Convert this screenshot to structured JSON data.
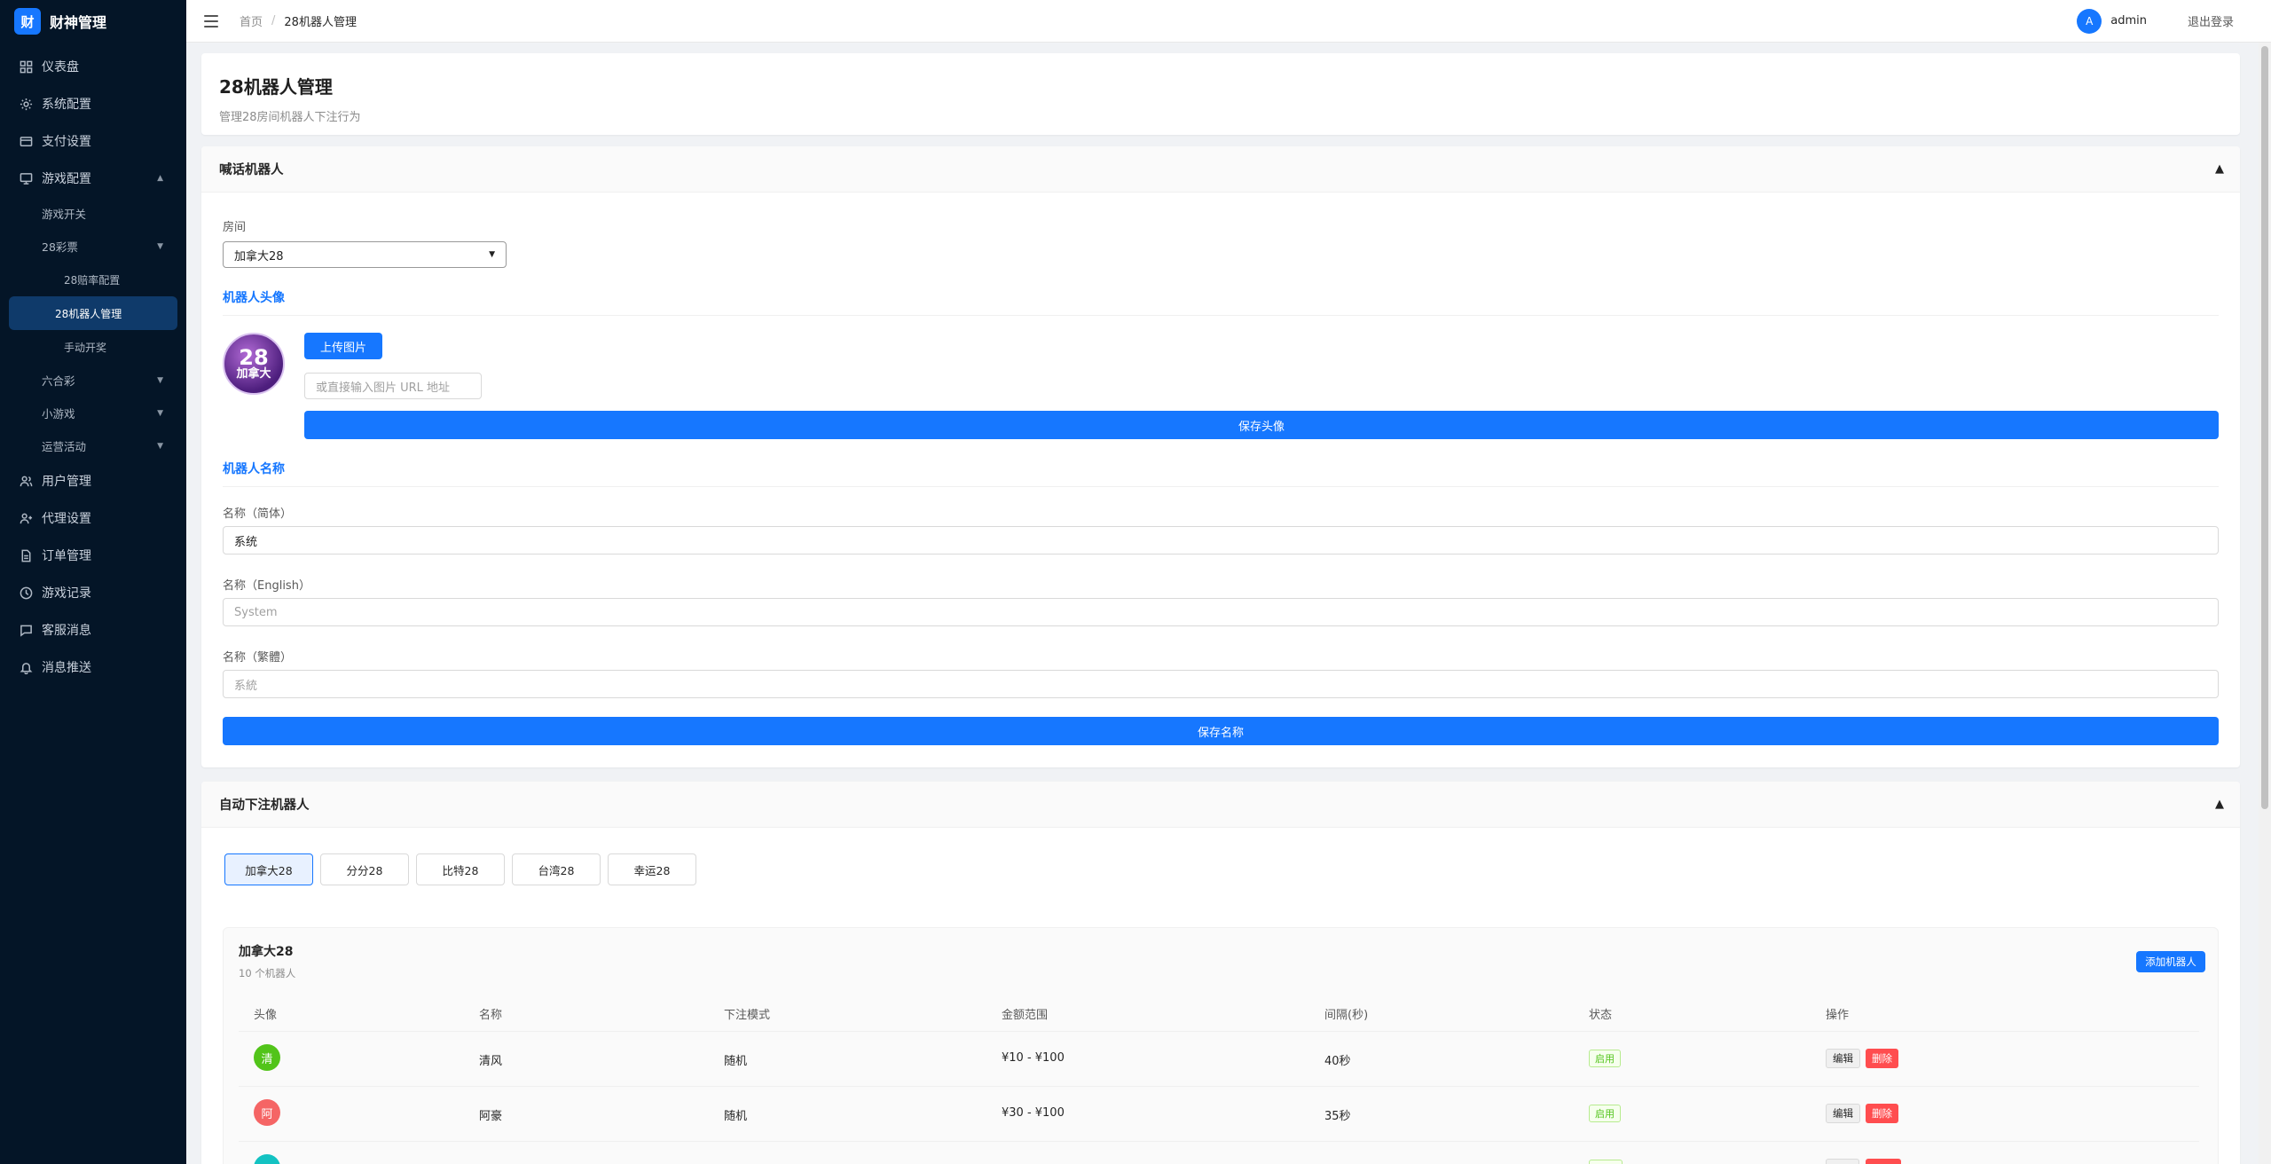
{
  "brand": {
    "logo_char": "财",
    "name": "财神管理"
  },
  "sidebar": {
    "items": [
      {
        "label": "仪表盘",
        "icon": "dashboard-icon"
      },
      {
        "label": "系统配置",
        "icon": "gear-icon"
      },
      {
        "label": "支付设置",
        "icon": "credit-card-icon"
      },
      {
        "label": "游戏配置",
        "icon": "monitor-icon"
      },
      {
        "label": "用户管理",
        "icon": "users-icon"
      },
      {
        "label": "代理设置",
        "icon": "user-plus-icon"
      },
      {
        "label": "订单管理",
        "icon": "document-icon"
      },
      {
        "label": "游戏记录",
        "icon": "clock-icon"
      },
      {
        "label": "客服消息",
        "icon": "chat-icon"
      },
      {
        "label": "消息推送",
        "icon": "bell-icon"
      }
    ],
    "game_sub": [
      "游戏开关",
      "28彩票",
      "六合彩",
      "小游戏",
      "运营活动"
    ],
    "lottery_sub": [
      "28赔率配置",
      "28机器人管理",
      "手动开奖"
    ]
  },
  "header": {
    "breadcrumb_home": "首页",
    "breadcrumb_sep": "/",
    "breadcrumb_current": "28机器人管理",
    "avatar_letter": "A",
    "user": "admin",
    "logout": "退出登录"
  },
  "page": {
    "title": "28机器人管理",
    "desc": "管理28房间机器人下注行为"
  },
  "talk_robot": {
    "title": "喊话机器人",
    "collapse": "▲",
    "room_label": "房间",
    "room_value": "加拿大28",
    "avatar_title": "机器人头像",
    "avatar_text_top": "28",
    "avatar_text_bottom": "加拿大",
    "upload_label": "上传图片",
    "url_placeholder": "或直接输入图片 URL 地址",
    "save_avatar": "保存头像",
    "name_title": "机器人名称",
    "name_cn_label": "名称（简体）",
    "name_cn_value": "系统",
    "name_en_label": "名称（English）",
    "name_en_placeholder": "System",
    "name_tw_label": "名称（繁體）",
    "name_tw_placeholder": "系統",
    "save_name": "保存名称"
  },
  "auto_robot": {
    "title": "自动下注机器人",
    "collapse": "▲",
    "tabs": [
      "加拿大28",
      "分分28",
      "比特28",
      "台湾28",
      "幸运28"
    ],
    "panel_title": "加拿大28",
    "panel_count": "10 个机器人",
    "add_button": "添加机器人",
    "columns": [
      "头像",
      "名称",
      "下注模式",
      "金额范围",
      "间隔(秒)",
      "状态",
      "操作"
    ],
    "rows": [
      {
        "avatar": "清",
        "color": "#52c41a",
        "name": "清风",
        "mode": "随机",
        "range": "¥10 - ¥100",
        "interval": "40秒",
        "status": "启用",
        "edit": "编辑",
        "del": "删除"
      },
      {
        "avatar": "阿",
        "color": "#f56565",
        "name": "阿豪",
        "mode": "随机",
        "range": "¥30 - ¥100",
        "interval": "35秒",
        "status": "启用",
        "edit": "编辑",
        "del": "删除"
      },
      {
        "avatar": "",
        "color": "#13c2c2",
        "name": "",
        "mode": "",
        "range": "",
        "interval": "",
        "status": "",
        "edit": "",
        "del": ""
      }
    ]
  },
  "colors": {
    "primary": "#1677ff",
    "sidebar_bg": "#041527",
    "success": "#52c41a",
    "danger": "#ff4d4f"
  }
}
